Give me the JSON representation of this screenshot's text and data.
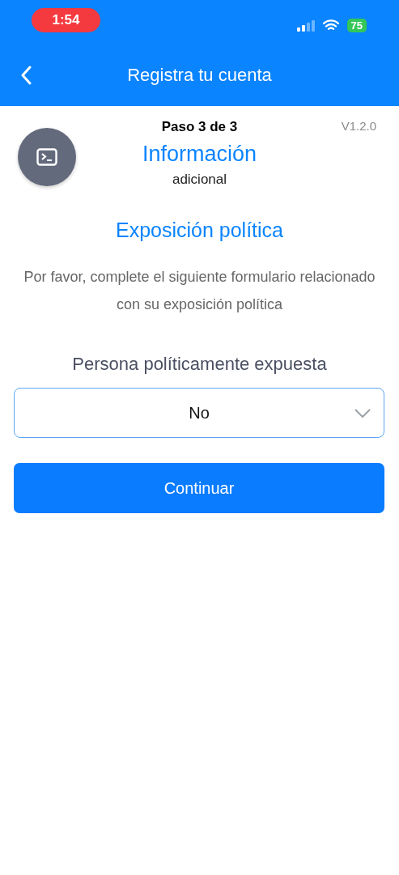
{
  "status_bar": {
    "time": "1:54",
    "battery": "75"
  },
  "nav": {
    "title": "Registra tu cuenta"
  },
  "header": {
    "step": "Paso 3 de 3",
    "version": "V1.2.0",
    "title": "Información",
    "subtitle": "adicional"
  },
  "section": {
    "title": "Exposición política",
    "description": "Por favor, complete el siguiente formulario relacionado con su exposición política"
  },
  "field": {
    "label": "Persona políticamente expuesta",
    "value": "No"
  },
  "buttons": [
    "Continuar"
  ]
}
